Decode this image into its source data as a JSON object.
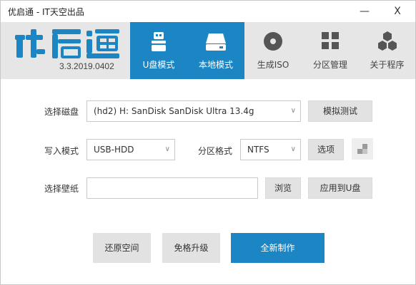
{
  "window": {
    "title": "优启通 - IT天空出品",
    "minimize": "—",
    "close": "X"
  },
  "header": {
    "logo_text": "优启通",
    "version": "3.3.2019.0402",
    "tabs": [
      {
        "label": "U盘模式",
        "icon": "usb-drive-icon",
        "active": true
      },
      {
        "label": "本地模式",
        "icon": "hard-disk-icon",
        "active": false
      },
      {
        "label": "生成ISO",
        "icon": "disc-icon",
        "active": false
      },
      {
        "label": "分区管理",
        "icon": "partition-grid-icon",
        "active": false
      },
      {
        "label": "关于程序",
        "icon": "cubes-icon",
        "active": false
      }
    ],
    "accent": "#1c86c5"
  },
  "form": {
    "disk_label": "选择磁盘",
    "disk_value": "(hd2) H: SanDisk SanDisk Ultra 13.4g",
    "simulate_button": "模拟测试",
    "write_mode_label": "写入模式",
    "write_mode_value": "USB-HDD",
    "partition_format_label": "分区格式",
    "partition_format_value": "NTFS",
    "options_button": "选项",
    "wallpaper_label": "选择壁纸",
    "wallpaper_value": "",
    "browse_button": "浏览",
    "apply_button": "应用到U盘"
  },
  "actions": {
    "restore_button": "还原空间",
    "upgrade_button": "免格升级",
    "create_button": "全新制作"
  }
}
